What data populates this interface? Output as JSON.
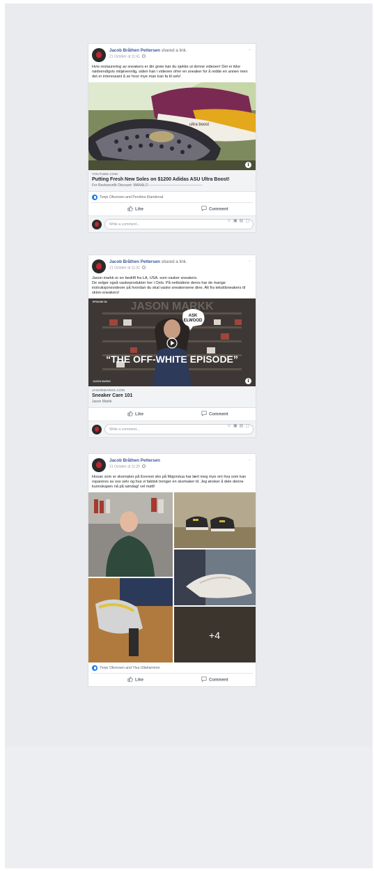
{
  "posts": [
    {
      "author": "Jacob Bråthen Pettersen",
      "action": "shared a link.",
      "time": "21 October at 11:41",
      "text": "Hvis restaurering av sneakers er din greie bør du sjekke ut denne videoen! Det er ikke nødvendigvis miljøvennlig, siden han i videoen ofrer en sneaker for å redde en annen men det er interessant å se hvor mye man kan fa til selv!",
      "image_label": "ultra boost",
      "link": {
        "domain": "YOUTUBE.COM",
        "title": "Putting Fresh New Soles on $1200 Adidas ASU Ultra Boost!",
        "desc": "For Reshoevn8r Discount: MANALO ----------------------------------------------"
      },
      "reactions": "Tonje Oliversen and Perolina Klanderud",
      "like_label": "Like",
      "comment_label": "Comment",
      "comment_placeholder": "Write a comment..."
    },
    {
      "author": "Jacob Bråthen Pettersen",
      "action": "shared a link.",
      "time": "21 October at 11:32",
      "text": "Jason markk er en bedrift fra LA, USA. som vasker sneakers.\nDe selger også vaskeprodukter her i Oslo. På nettsidene deres har de mange instruksjonsvideoer på hvordan du skal vaske sneakersene dine. Alt fra tekstilsneakers til skinn-sneakers!",
      "video": {
        "episode_tag": "EPISODE 08",
        "bg_title": "JASON MARKK",
        "badge_line1": "ASK",
        "badge_line2": "ELWOOD",
        "headline": "“THE OFF-WHITE EPISODE”",
        "corner_logo": "JASON MARKK"
      },
      "link": {
        "domain": "JASONMARKK.COM",
        "title": "Sneaker Care 101",
        "desc": "Jason Markk"
      },
      "like_label": "Like",
      "comment_label": "Comment",
      "comment_placeholder": "Write a comment..."
    },
    {
      "author": "Jacob Bråthen Pettersen",
      "action": "",
      "time": "21 October at 11:20",
      "text": "Hosan som er skomaker på Everest sko på Majorstua har lært meg mye om hva som kan repareres av oss selv og hva vi faktisk trenger en skomaker til. Jeg ønsker å dele denne kunnskapen nå på søndag! vel møtt!",
      "more_photos": "+4",
      "reactions": "Tonje Oliversen and Ylva Ullahammer",
      "like_label": "Like",
      "comment_label": "Comment"
    }
  ],
  "colors": {
    "link_blue": "#385898",
    "facebook_blue": "#1877f2",
    "bg": "#e9ebee"
  }
}
